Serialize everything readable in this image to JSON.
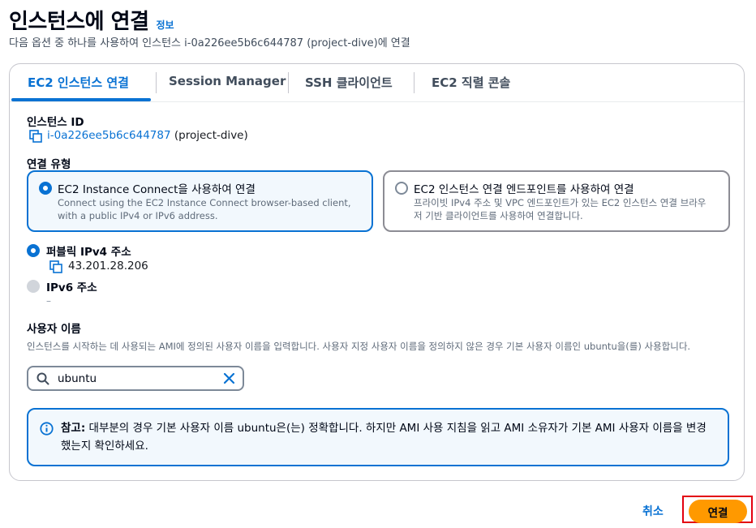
{
  "header": {
    "title": "인스턴스에 연결",
    "info_link": "정보",
    "subtitle": "다음 옵션 중 하나를 사용하여 인스턴스 i-0a226ee5b6c644787 (project-dive)에 연결"
  },
  "tabs": [
    {
      "label": "EC2 인스턴스 연결",
      "active": true
    },
    {
      "label": "Session Manager",
      "active": false
    },
    {
      "label": "SSH 클라이언트",
      "active": false
    },
    {
      "label": "EC2 직렬 콘솔",
      "active": false
    }
  ],
  "instance": {
    "label": "인스턴스 ID",
    "id": "i-0a226ee5b6c644787",
    "name": "(project-dive)"
  },
  "connection_type": {
    "label": "연결 유형",
    "options": [
      {
        "title": "EC2 Instance Connect을 사용하여 연결",
        "description": "Connect using the EC2 Instance Connect browser-based client, with a public IPv4 or IPv6 address.",
        "selected": true
      },
      {
        "title": "EC2 인스턴스 연결 엔드포인트를 사용하여 연결",
        "description": "프라이빗 IPv4 주소 및 VPC 엔드포인트가 있는 EC2 인스턴스 연결 브라우저 기반 클라이언트를 사용하여 연결합니다.",
        "selected": false
      }
    ]
  },
  "address": {
    "public_ipv4": {
      "label": "퍼블릭 IPv4 주소",
      "value": "43.201.28.206",
      "selected": true
    },
    "ipv6": {
      "label": "IPv6 주소",
      "value": "–",
      "selected": false,
      "disabled": true
    }
  },
  "username": {
    "label": "사용자 이름",
    "help": "인스턴스를 시작하는 데 사용되는 AMI에 정의된 사용자 이름을 입력합니다. 사용자 지정 사용자 이름을 정의하지 않은 경우 기본 사용자 이름인 ubuntu을(를) 사용합니다.",
    "value": "ubuntu"
  },
  "alert": {
    "prefix": "참고:",
    "text": "대부분의 경우 기본 사용자 이름 ubuntu은(는) 정확합니다. 하지만 AMI 사용 지침을 읽고 AMI 소유자가 기본 AMI 사용자 이름을 변경했는지 확인하세요."
  },
  "footer": {
    "cancel": "취소",
    "connect": "연결"
  },
  "colors": {
    "accent": "#0972d3",
    "primary_button": "#ff9900",
    "highlight": "#e3000f"
  },
  "icons": [
    "copy-icon",
    "search-icon",
    "clear-icon",
    "info-icon"
  ]
}
